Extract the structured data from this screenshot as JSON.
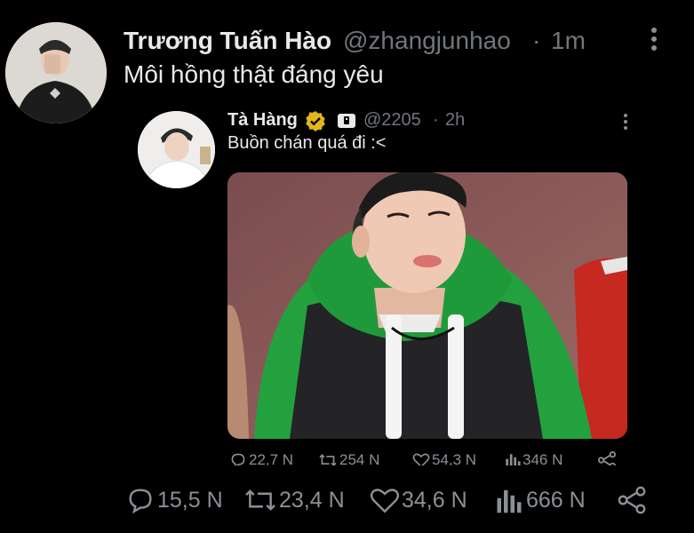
{
  "tweet": {
    "display_name": "Trương Tuấn Hào",
    "handle": "@zhangjunhao",
    "separator": "·",
    "time": "1m",
    "text": "Môi hồng thật đáng yêu",
    "actions": {
      "replies": "15,5 N",
      "retweets": "23,4 N",
      "likes": "34,6 N",
      "views": "666 N"
    }
  },
  "quoted": {
    "display_name": "Tà Hàng",
    "handle": "@2205",
    "separator": "·",
    "time": "2h",
    "text": "Buồn chán quá đi :<",
    "actions": {
      "replies": "22,7 N",
      "retweets": "254 N",
      "likes": "54,3 N",
      "views": "346 N"
    }
  },
  "colors": {
    "background": "#000000",
    "text": "#e7e9ea",
    "muted": "#71767b",
    "verified_badge": "#e2b719"
  }
}
